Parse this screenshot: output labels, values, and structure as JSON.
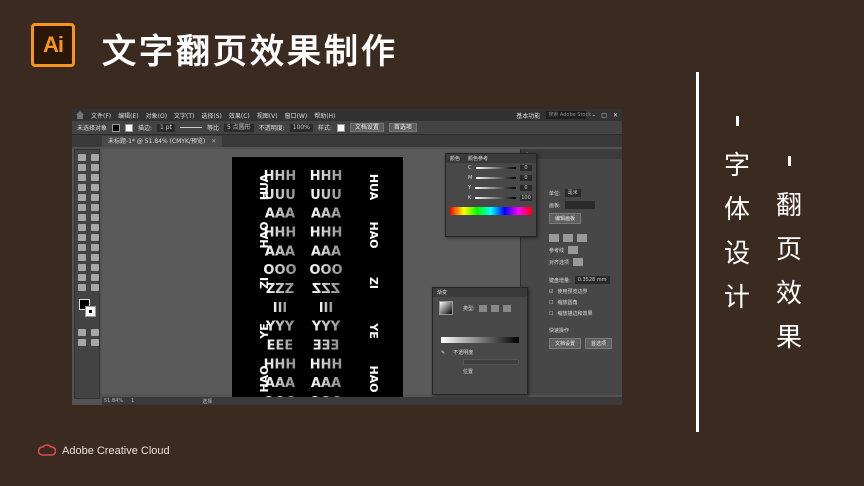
{
  "slide": {
    "logo": "Ai",
    "title": "文字翻页效果制作",
    "side_col1": [
      "字",
      "体",
      "设",
      "计"
    ],
    "side_col2": [
      "翻",
      "页",
      "效",
      "果"
    ],
    "footer_brand": "Adobe Creative Cloud"
  },
  "app": {
    "menu": [
      "文件(F)",
      "编辑(E)",
      "对象(O)",
      "文字(T)",
      "选择(S)",
      "效果(C)",
      "视图(V)",
      "窗口(W)",
      "帮助(H)"
    ],
    "workspace": "基本功能",
    "search_placeholder": "搜索 Adobe Stock",
    "control": {
      "selection_label": "未选择对象",
      "stroke_label": "描边:",
      "stroke_value": "1 pt",
      "stroke_style": "等比",
      "brush": "5 点圆形",
      "opacity_label": "不透明度:",
      "opacity_value": "100%",
      "style_label": "样式:",
      "doc_setup": "文档设置",
      "prefs": "首选项"
    },
    "doc_tab": "未标题-1* @ 51.84% (CMYK/预览)",
    "status_zoom": "51.84%",
    "status_page": "1",
    "status_mode": "选择",
    "color_panel": {
      "tabs": [
        "颜色",
        "颜色参考"
      ],
      "channels": [
        {
          "label": "C",
          "value": "0"
        },
        {
          "label": "M",
          "value": "0"
        },
        {
          "label": "Y",
          "value": "0"
        },
        {
          "label": "K",
          "value": "100"
        }
      ]
    },
    "gradient_panel": {
      "title": "渐变",
      "type_label": "类型:",
      "opacity_label": "不透明度",
      "location_label": "位置"
    },
    "properties": {
      "unit_label": "单位:",
      "unit_value": "毫米",
      "artboard_label": "画板:",
      "edit_artboard": "编辑画板",
      "ref_point": "参考线",
      "snap": "对齐选项",
      "keyboard_inc_label": "键盘增量:",
      "keyboard_inc_value": "0.3528 mm",
      "use_preview": "使用预览边界",
      "corner": "缩放圆角",
      "stroke_effects": "缩放描边和效果",
      "quick_ops": "快速操作",
      "doc_setup": "文档设置",
      "prefs": "首选项"
    }
  },
  "artwork": {
    "left_col": [
      "HHH",
      "UUU",
      "AAA",
      "HHH",
      "AAA",
      "OOO",
      "ZZZ",
      "III",
      "YYY",
      "EEE",
      "HHH",
      "AAA",
      "OOO"
    ],
    "right_col": [
      "HUA",
      "HAO",
      "ZI",
      "YE",
      "HAO"
    ]
  }
}
